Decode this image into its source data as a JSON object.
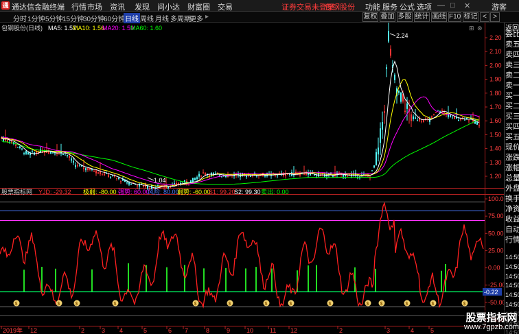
{
  "app": {
    "name": "通达信金融终端"
  },
  "menu": {
    "items": [
      "行情",
      "市场",
      "资讯",
      "发现",
      "问小达",
      "财富圈",
      "交易"
    ],
    "alert": "证券交易未登录",
    "stock": "包钢股份",
    "right": [
      "功能",
      "服务",
      "公式",
      "选项"
    ],
    "user": "游客"
  },
  "toolbar": {
    "periods": [
      "分时",
      "1分钟",
      "5分钟",
      "15分钟",
      "30分钟",
      "60分钟",
      "日线",
      "周线",
      "月线",
      "多周期",
      "更多"
    ],
    "active_period": "日线",
    "buttons": [
      "复权",
      "叠加",
      "多股",
      "统计",
      "画线",
      "F10",
      "标记"
    ]
  },
  "kline": {
    "title": "包钢股份(日线)",
    "ma5": "MA5: 1.57",
    "ma10": "MA10: 1.56",
    "ma20": "MA20: 1.59",
    "ma60": "MA60: 1.60",
    "high_marker": "2.24",
    "low_marker": "1.04",
    "y_ticks": [
      "2.20",
      "2.10",
      "2.00",
      "1.90",
      "1.80",
      "1.70",
      "1.60",
      "1.50",
      "1.40",
      "1.30",
      "1.20"
    ],
    "colors": {
      "ma5": "#ffffff",
      "ma10": "#ffff00",
      "ma20": "#ff00ff",
      "ma60": "#00ff00",
      "up": "#ff3333",
      "down": "#54ffff"
    }
  },
  "indicator": {
    "title": "股票指标网",
    "yjd": "YJD: -29.32",
    "jiruo": "极弱: -80.00",
    "qiangshi": "强势: 60.00",
    "fengxian": "风险: 80.00",
    "ruoshi": "弱势: -60.00",
    "s1": "S1: 99.20",
    "s2": "S2: 99.30",
    "maichu": "卖出: 0.00",
    "y_ticks": [
      "100.0",
      "75.00",
      "50.00",
      "25.00",
      "0.00",
      "-25.00",
      "-50.00",
      "-75.00"
    ],
    "current_value": "-0.22"
  },
  "time_axis": {
    "labels": [
      "2019年",
      "12",
      "2",
      "3",
      "4",
      "5",
      "6",
      "7",
      "8",
      "9",
      "10",
      "11",
      "12",
      "2",
      "3",
      "4",
      "5"
    ]
  },
  "side_panel": {
    "close_label": "返回",
    "labels": [
      "委比",
      "卖五",
      "卖四",
      "卖三",
      "卖二",
      "卖一",
      "买一",
      "买二",
      "买三",
      "买四",
      "买五",
      "现价",
      "涨跌",
      "涨幅",
      "总量",
      "外盘",
      "换手",
      "净资",
      "收益",
      "自动",
      "行情"
    ],
    "times": [
      "14:50",
      "14:50",
      "14:50",
      "14:50",
      "14:50",
      "14:50",
      "14:50",
      "14:50",
      "14:50"
    ]
  },
  "watermark": {
    "line1": "股票指标网",
    "line2": "www.7gpzb.com"
  }
}
